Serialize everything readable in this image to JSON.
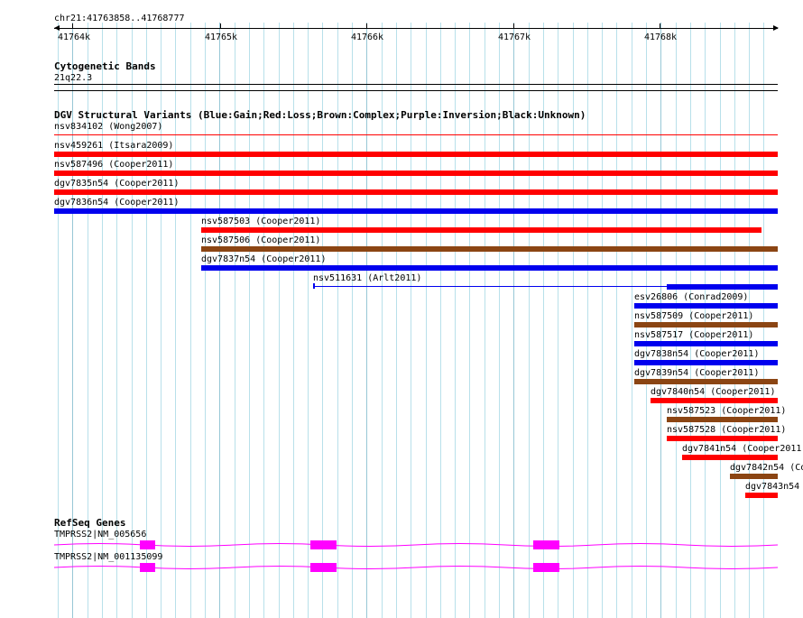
{
  "ruler": {
    "coord_label": "chr21:41763858..41768777",
    "ticks": [
      "41764k",
      "41765k",
      "41766k",
      "41767k",
      "41768k"
    ]
  },
  "cyto": {
    "title": "Cytogenetic Bands",
    "band": "21q22.3"
  },
  "dgv": {
    "title": "DGV Structural Variants (Blue:Gain;Red:Loss;Brown:Complex;Purple:Inversion;Black:Unknown)",
    "colors": {
      "red": "#ff0000",
      "blue": "#0000ee",
      "brown": "#8b4513"
    },
    "variants": [
      {
        "label": "nsv834102 (Wong2007)",
        "color": "#ff0000",
        "thin": true
      },
      {
        "label": "nsv459261 (Itsara2009)",
        "color": "#ff0000"
      },
      {
        "label": "nsv587496 (Cooper2011)",
        "color": "#ff0000"
      },
      {
        "label": "dgv7835n54 (Cooper2011)",
        "color": "#ff0000"
      },
      {
        "label": "dgv7836n54 (Cooper2011)",
        "color": "#0000ee"
      },
      {
        "label": "nsv587503 (Cooper2011)",
        "color": "#ff0000"
      },
      {
        "label": "nsv587506 (Cooper2011)",
        "color": "#8b4513"
      },
      {
        "label": "dgv7837n54 (Cooper2011)",
        "color": "#0000ee"
      },
      {
        "label": "nsv511631 (Arlt2011)",
        "color": "#0000ee"
      },
      {
        "label": "esv26806 (Conrad2009)",
        "color": "#0000ee"
      },
      {
        "label": "nsv587509 (Cooper2011)",
        "color": "#8b4513"
      },
      {
        "label": "nsv587517 (Cooper2011)",
        "color": "#0000ee"
      },
      {
        "label": "dgv7838n54 (Cooper2011)",
        "color": "#0000ee"
      },
      {
        "label": "dgv7839n54 (Cooper2011)",
        "color": "#8b4513"
      },
      {
        "label": "dgv7840n54 (Cooper2011)",
        "color": "#ff0000"
      },
      {
        "label": "nsv587523 (Cooper2011)",
        "color": "#8b4513"
      },
      {
        "label": "nsv587528 (Cooper2011)",
        "color": "#ff0000"
      },
      {
        "label": "dgv7841n54 (Cooper2011)",
        "color": "#ff0000"
      },
      {
        "label": "dgv7842n54 (Co",
        "color": "#8b4513"
      },
      {
        "label": "dgv7843n54",
        "color": "#ff0000"
      }
    ]
  },
  "refseq": {
    "title": "RefSeq Genes",
    "color": "#ff00ff",
    "genes": [
      {
        "label": "TMPRSS2|NM_005656"
      },
      {
        "label": "TMPRSS2|NM_001135099"
      }
    ]
  }
}
